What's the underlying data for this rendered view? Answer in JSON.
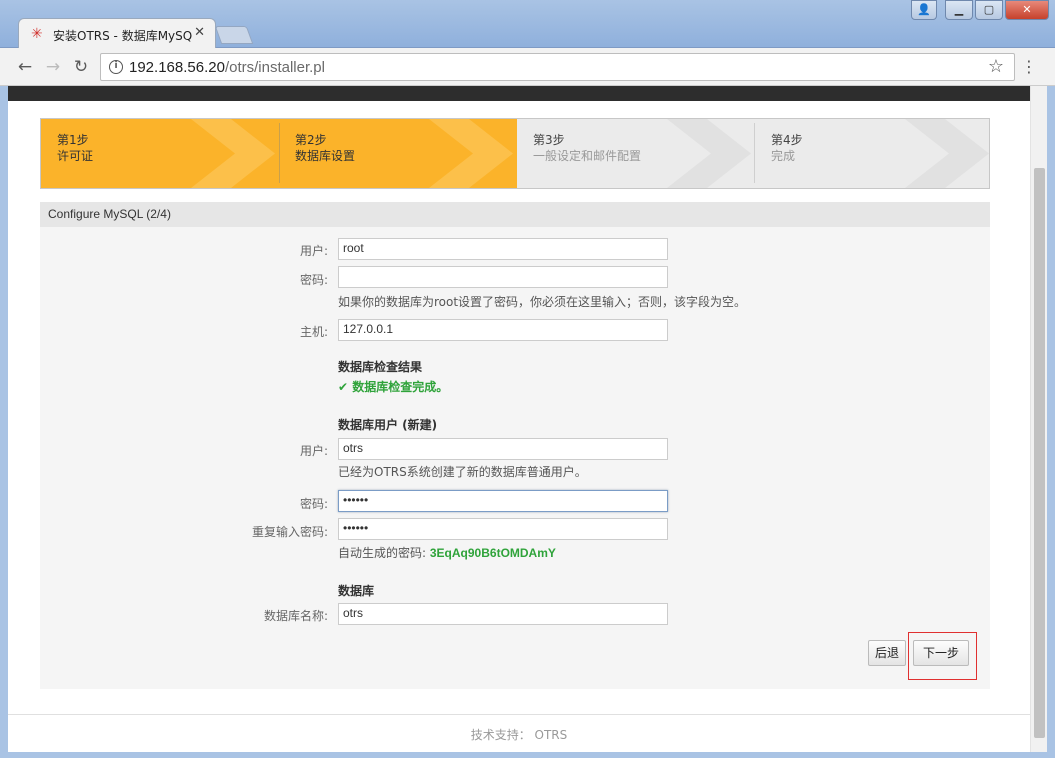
{
  "browser": {
    "tab_title": "安装OTRS - 数据库MySQL",
    "url_host": "192.168.56.20",
    "url_path": "/otrs/installer.pl"
  },
  "steps": [
    {
      "num": "第1步",
      "label": "许可证",
      "state": "done"
    },
    {
      "num": "第2步",
      "label": "数据库设置",
      "state": "active"
    },
    {
      "num": "第3步",
      "label": "一般设定和邮件配置",
      "state": "pending"
    },
    {
      "num": "第4步",
      "label": "完成",
      "state": "pending"
    }
  ],
  "section_header": "Configure MySQL (2/4)",
  "form": {
    "root_user_label": "用户:",
    "root_user_value": "root",
    "root_password_label": "密码:",
    "root_password_value": "",
    "root_password_hint": "如果你的数据库为root设置了密码，你必须在这里输入；否则，该字段为空。",
    "host_label": "主机:",
    "host_value": "127.0.0.1",
    "check_title": "数据库检查结果",
    "check_result": "数据库检查完成。",
    "new_user_title": "数据库用户 (新建)",
    "db_user_label": "用户:",
    "db_user_value": "otrs",
    "db_user_hint": "已经为OTRS系统创建了新的数据库普通用户。",
    "db_password_label": "密码:",
    "db_password_value": "••••••",
    "db_password_repeat_label": "重复输入密码:",
    "db_password_repeat_value": "••••••",
    "generated_password_label": "自动生成的密码:",
    "generated_password_value": "3EqAq90B6tOMDAmY",
    "database_title": "数据库",
    "db_name_label": "数据库名称:",
    "db_name_value": "otrs"
  },
  "buttons": {
    "back": "后退",
    "next": "下一步"
  },
  "footer": "技术支持： OTRS",
  "colors": {
    "step_active": "#fbb32a",
    "success": "#2fa33a",
    "highlight": "#e03030"
  }
}
